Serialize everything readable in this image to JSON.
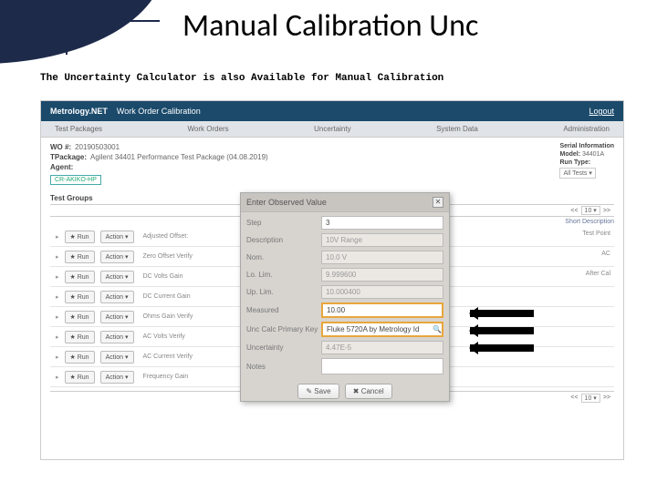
{
  "slide": {
    "title": "Manual Calibration Unc",
    "subtitle": "The Uncertainty Calculator is also Available for Manual Calibration"
  },
  "app": {
    "brand": "Metrology.NET",
    "header_title": "Work Order Calibration",
    "logout": "Logout",
    "nav": [
      "Test Packages",
      "Work Orders",
      "Uncertainty",
      "System Data",
      "Administration"
    ],
    "wo": {
      "label": "WO #:",
      "value": "20190503001"
    },
    "tpackage": {
      "label": "TPackage:",
      "value": "Agilent 34401 Performance Test Package (04.08.2019)"
    },
    "agent": {
      "label": "Agent:",
      "value": "CR-AKIKO-HP"
    },
    "right": {
      "serial_label": "Serial Information",
      "model_label": "Model:",
      "model_value": "34401A",
      "run_label": "Run Type:",
      "run_value": "All Tests"
    },
    "test_groups_label": "Test Groups",
    "paging": {
      "prev": "<<",
      "per": "10",
      "next": ">>"
    },
    "short_desc": "Short Description",
    "rows": [
      {
        "run": "★ Run",
        "action": "Action ▾",
        "desc": "Adjusted Offset:"
      },
      {
        "run": "★ Run",
        "action": "Action ▾",
        "desc": "Zero Offset Verify"
      },
      {
        "run": "★ Run",
        "action": "Action ▾",
        "desc": "DC Volts Gain"
      },
      {
        "run": "★ Run",
        "action": "Action ▾",
        "desc": "DC Current Gain"
      },
      {
        "run": "★ Run",
        "action": "Action ▾",
        "desc": "Ohms Gain Verify"
      },
      {
        "run": "★ Run",
        "action": "Action ▾",
        "desc": "AC Volts Verify"
      },
      {
        "run": "★ Run",
        "action": "Action ▾",
        "desc": "AC Current Verify"
      },
      {
        "run": "★ Run",
        "action": "Action ▾",
        "desc": "Frequency Gain"
      }
    ],
    "right_col": [
      "Test Point",
      "AC",
      "After Cal"
    ]
  },
  "modal": {
    "title": "Enter Observed Value",
    "close": "✕",
    "fields": {
      "step_label": "Step",
      "step_value": "3",
      "desc_label": "Description",
      "desc_value": "10V Range",
      "nom_label": "Nom.",
      "nom_value": "10.0 V",
      "lolim_label": "Lo. Lim.",
      "lolim_value": "9.999600",
      "uplim_label": "Up. Lim.",
      "uplim_value": "10.000400",
      "measured_label": "Measured",
      "measured_value": "10.00",
      "unckey_label": "Unc Calc Primary Key",
      "unckey_value": "Fluke 5720A by Metrology Id",
      "uncertainty_label": "Uncertainty",
      "uncertainty_value": "4.47E-5",
      "notes_label": "Notes",
      "notes_value": ""
    },
    "buttons": {
      "save": "✎ Save",
      "cancel": "✖ Cancel"
    }
  }
}
